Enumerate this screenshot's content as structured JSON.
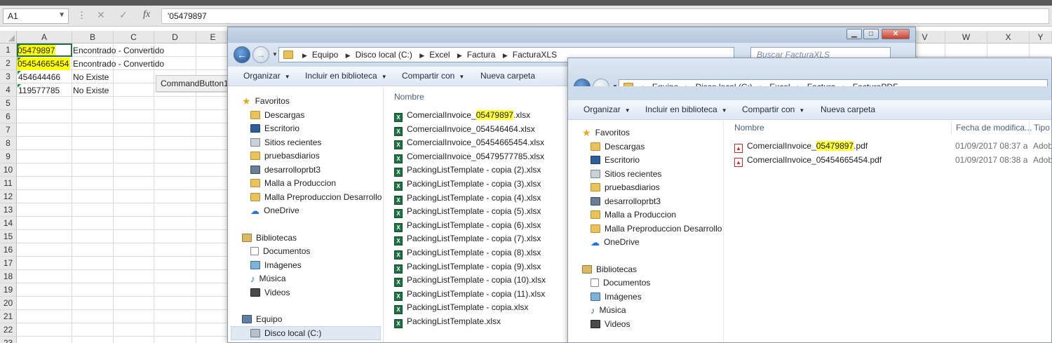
{
  "excel": {
    "name_box": "A1",
    "formula_value": "'05479897",
    "fx_label": "fx",
    "columns": [
      "A",
      "B",
      "C",
      "D",
      "E",
      "V",
      "W",
      "X",
      "Y"
    ],
    "rows": [
      "1",
      "2",
      "3",
      "4",
      "5",
      "6",
      "7",
      "8",
      "9",
      "10",
      "11",
      "12",
      "13",
      "14",
      "15",
      "16",
      "17",
      "18",
      "19",
      "20",
      "21",
      "22",
      "23"
    ],
    "data": [
      {
        "a": "05479897",
        "b": "Encontrado - Convertido",
        "highlight": true
      },
      {
        "a": "05454665454",
        "b": "Encontrado - Convertido",
        "highlight": true
      },
      {
        "a": "454644466",
        "b": "No Existe",
        "highlight": false
      },
      {
        "a": "119577785",
        "b": "No Existe",
        "highlight": false
      }
    ],
    "command_button": "CommandButton1"
  },
  "explorer_xls": {
    "path": [
      "Equipo",
      "Disco local (C:)",
      "Excel",
      "Factura",
      "FacturaXLS"
    ],
    "search_placeholder": "Buscar FacturaXLS",
    "toolbar": {
      "organize": "Organizar",
      "include": "Incluir en biblioteca",
      "share": "Compartir con",
      "new_folder": "Nueva carpeta"
    },
    "column_name": "Nombre",
    "files": [
      {
        "pre": "ComercialInvoice_",
        "hl": "05479897",
        "post": ".xlsx"
      },
      {
        "pre": "ComercialInvoice_054546464.xlsx",
        "hl": "",
        "post": ""
      },
      {
        "pre": "ComercialInvoice_05454665454.xlsx",
        "hl": "",
        "post": ""
      },
      {
        "pre": "ComercialInvoice_05479577785.xlsx",
        "hl": "",
        "post": ""
      },
      {
        "pre": "PackingListTemplate - copia (2).xlsx",
        "hl": "",
        "post": ""
      },
      {
        "pre": "PackingListTemplate - copia (3).xlsx",
        "hl": "",
        "post": ""
      },
      {
        "pre": "PackingListTemplate - copia (4).xlsx",
        "hl": "",
        "post": ""
      },
      {
        "pre": "PackingListTemplate - copia (5).xlsx",
        "hl": "",
        "post": ""
      },
      {
        "pre": "PackingListTemplate - copia (6).xlsx",
        "hl": "",
        "post": ""
      },
      {
        "pre": "PackingListTemplate - copia (7).xlsx",
        "hl": "",
        "post": ""
      },
      {
        "pre": "PackingListTemplate - copia (8).xlsx",
        "hl": "",
        "post": ""
      },
      {
        "pre": "PackingListTemplate - copia (9).xlsx",
        "hl": "",
        "post": ""
      },
      {
        "pre": "PackingListTemplate - copia (10).xlsx",
        "hl": "",
        "post": ""
      },
      {
        "pre": "PackingListTemplate - copia (11).xlsx",
        "hl": "",
        "post": ""
      },
      {
        "pre": "PackingListTemplate - copia.xlsx",
        "hl": "",
        "post": ""
      },
      {
        "pre": "PackingListTemplate.xlsx",
        "hl": "",
        "post": ""
      }
    ]
  },
  "explorer_pdf": {
    "path": [
      "Equipo",
      "Disco local (C:)",
      "Excel",
      "Factura",
      "FacturaPDF"
    ],
    "toolbar": {
      "organize": "Organizar",
      "include": "Incluir en biblioteca",
      "share": "Compartir con",
      "new_folder": "Nueva carpeta"
    },
    "column_name": "Nombre",
    "column_date": "Fecha de modifica...",
    "column_type": "Tipo",
    "files": [
      {
        "pre": "ComercialInvoice_",
        "hl": "05479897",
        "post": ".pdf",
        "date": "01/09/2017 08:37 a...",
        "type": "Adob"
      },
      {
        "pre": "ComercialInvoice_05454665454.pdf",
        "hl": "",
        "post": "",
        "date": "01/09/2017 08:38 a...",
        "type": "Adob"
      }
    ]
  },
  "nav_pane": {
    "favorites": "Favoritos",
    "favorite_items": [
      {
        "label": "Descargas",
        "icon": "downloads-folder-icon"
      },
      {
        "label": "Escritorio",
        "icon": "desktop-icon"
      },
      {
        "label": "Sitios recientes",
        "icon": "recent-sites-icon"
      },
      {
        "label": "pruebasdiarios",
        "icon": "shortcut-icon"
      },
      {
        "label": "desarrolloprbt3",
        "icon": "network-icon"
      },
      {
        "label": "Malla a Produccion",
        "icon": "folder-icon"
      },
      {
        "label": "Malla Preproduccion Desarrollo",
        "icon": "folder-icon"
      },
      {
        "label": "OneDrive",
        "icon": "onedrive-icon"
      }
    ],
    "libraries": "Bibliotecas",
    "library_items": [
      {
        "label": "Documentos",
        "icon": "documents-icon"
      },
      {
        "label": "Imágenes",
        "icon": "pictures-icon"
      },
      {
        "label": "Música",
        "icon": "music-icon"
      },
      {
        "label": "Videos",
        "icon": "videos-icon"
      }
    ],
    "computer": "Equipo",
    "computer_items": [
      {
        "label": "Disco local (C:)",
        "icon": "local-disk-icon"
      }
    ]
  }
}
